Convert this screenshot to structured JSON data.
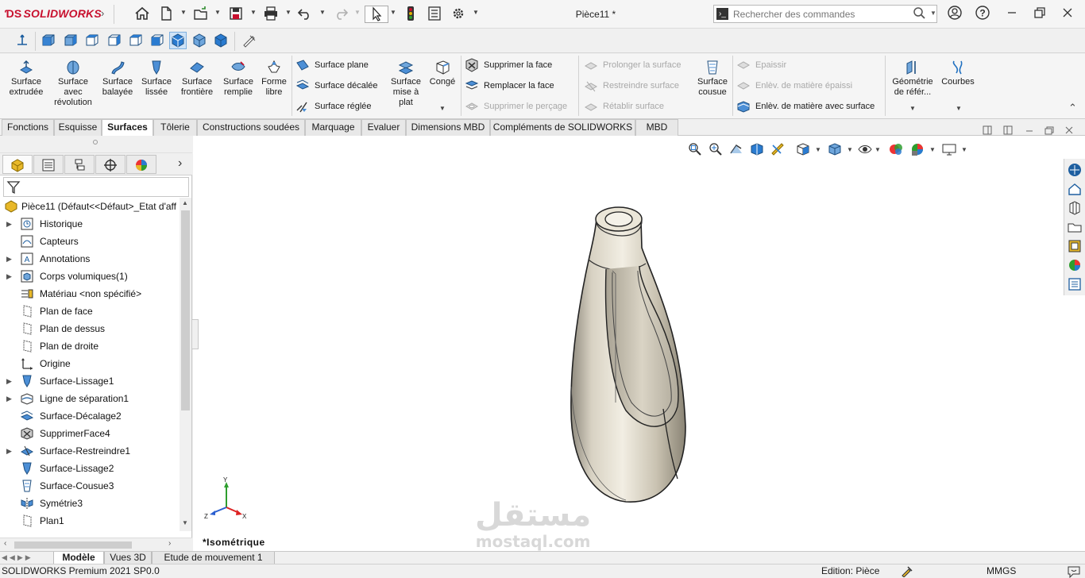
{
  "app": {
    "logo": "SOLIDWORKS",
    "doc_title": "Pièce11 *"
  },
  "search": {
    "placeholder": "Rechercher des commandes"
  },
  "ribbon": {
    "big_buttons": [
      {
        "label": "Surface\nextrudée",
        "icon": "extruded-surface-icon"
      },
      {
        "label": "Surface\navec\nrévolution",
        "icon": "revolved-surface-icon"
      },
      {
        "label": "Surface\nbalayée",
        "icon": "swept-surface-icon"
      },
      {
        "label": "Surface\nlissée",
        "icon": "lofted-surface-icon"
      },
      {
        "label": "Surface\nfrontière",
        "icon": "boundary-surface-icon"
      },
      {
        "label": "Surface\nremplie",
        "icon": "filled-surface-icon"
      },
      {
        "label": "Forme\nlibre",
        "icon": "freeform-icon"
      }
    ],
    "col1": [
      "Surface plane",
      "Surface décalée",
      "Surface réglée"
    ],
    "mid_big": [
      {
        "label": "Surface\nmise à\nplat"
      },
      {
        "label": "Congé"
      }
    ],
    "col2": [
      "Supprimer la face",
      "Remplacer la face",
      "Supprimer le perçage"
    ],
    "col3": [
      "Prolonger la surface",
      "Restreindre surface",
      "Rétablir surface"
    ],
    "knit": "Surface\ncousue",
    "col4": [
      "Epaissir",
      "Enlèv. de matière épaissi",
      "Enlèv. de matière avec surface"
    ],
    "ref_geo": "Géométrie\nde référ...",
    "curves": "Courbes"
  },
  "tabs": [
    "Fonctions",
    "Esquisse",
    "Surfaces",
    "Tôlerie",
    "Constructions soudées",
    "Marquage",
    "Evaluer",
    "Dimensions MBD",
    "Compléments de SOLIDWORKS",
    "MBD"
  ],
  "active_tab": "Surfaces",
  "tree": {
    "root": "Pièce11  (Défaut<<Défaut>_Etat d'aff",
    "items": [
      {
        "label": "Historique",
        "expand": true,
        "icon": "history-icon"
      },
      {
        "label": "Capteurs",
        "expand": false,
        "icon": "sensor-icon"
      },
      {
        "label": "Annotations",
        "expand": true,
        "icon": "annotations-icon"
      },
      {
        "label": "Corps volumiques(1)",
        "expand": true,
        "icon": "solid-bodies-icon"
      },
      {
        "label": "Matériau <non spécifié>",
        "expand": false,
        "icon": "material-icon"
      },
      {
        "label": "Plan de face",
        "expand": false,
        "icon": "plane-icon"
      },
      {
        "label": "Plan de dessus",
        "expand": false,
        "icon": "plane-icon"
      },
      {
        "label": "Plan de droite",
        "expand": false,
        "icon": "plane-icon"
      },
      {
        "label": "Origine",
        "expand": false,
        "icon": "origin-icon"
      },
      {
        "label": "Surface-Lissage1",
        "expand": true,
        "icon": "loft-icon"
      },
      {
        "label": "Ligne de séparation1",
        "expand": true,
        "icon": "split-line-icon"
      },
      {
        "label": "Surface-Décalage2",
        "expand": false,
        "icon": "offset-surface-icon"
      },
      {
        "label": "SupprimerFace4",
        "expand": false,
        "icon": "delete-face-icon"
      },
      {
        "label": "Surface-Restreindre1",
        "expand": true,
        "icon": "trim-surface-icon"
      },
      {
        "label": "Surface-Lissage2",
        "expand": false,
        "icon": "loft-icon"
      },
      {
        "label": "Surface-Cousue3",
        "expand": false,
        "icon": "knit-icon"
      },
      {
        "label": "Symétrie3",
        "expand": false,
        "icon": "mirror-icon"
      },
      {
        "label": "Plan1",
        "expand": false,
        "icon": "plane-icon"
      }
    ]
  },
  "viewport": {
    "view_label": "*Isométrique",
    "watermark_ar": "مستقل",
    "watermark_en": "mostaql.com",
    "triad": {
      "x": "X",
      "y": "Y",
      "z": "Z"
    }
  },
  "bottom_tabs": [
    "Modèle",
    "Vues 3D",
    "Etude de mouvement 1"
  ],
  "status": {
    "product": "SOLIDWORKS Premium 2021 SP0.0",
    "mode": "Edition: Pièce",
    "units": "MMGS"
  },
  "colors": {
    "brand_red": "#c8102e",
    "bottle": "#e3ddd0",
    "accent_blue": "#1e6fc0"
  }
}
